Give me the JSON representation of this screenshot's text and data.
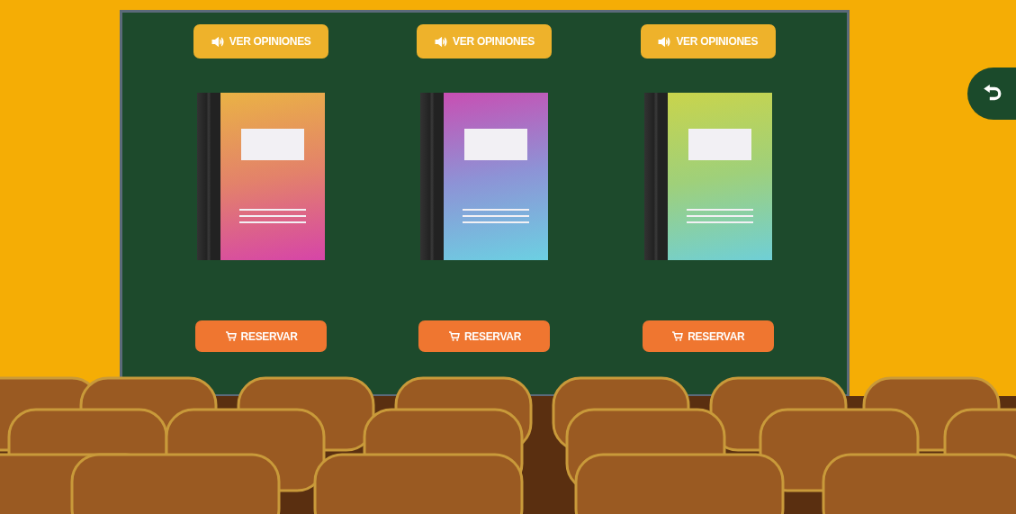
{
  "products": [
    {
      "review_button": "VER OPINIONES",
      "reserve_button": "RESERVAR"
    },
    {
      "review_button": "VER OPINIONES",
      "reserve_button": "RESERVAR"
    },
    {
      "review_button": "VER OPINIONES",
      "reserve_button": "RESERVAR"
    }
  ]
}
